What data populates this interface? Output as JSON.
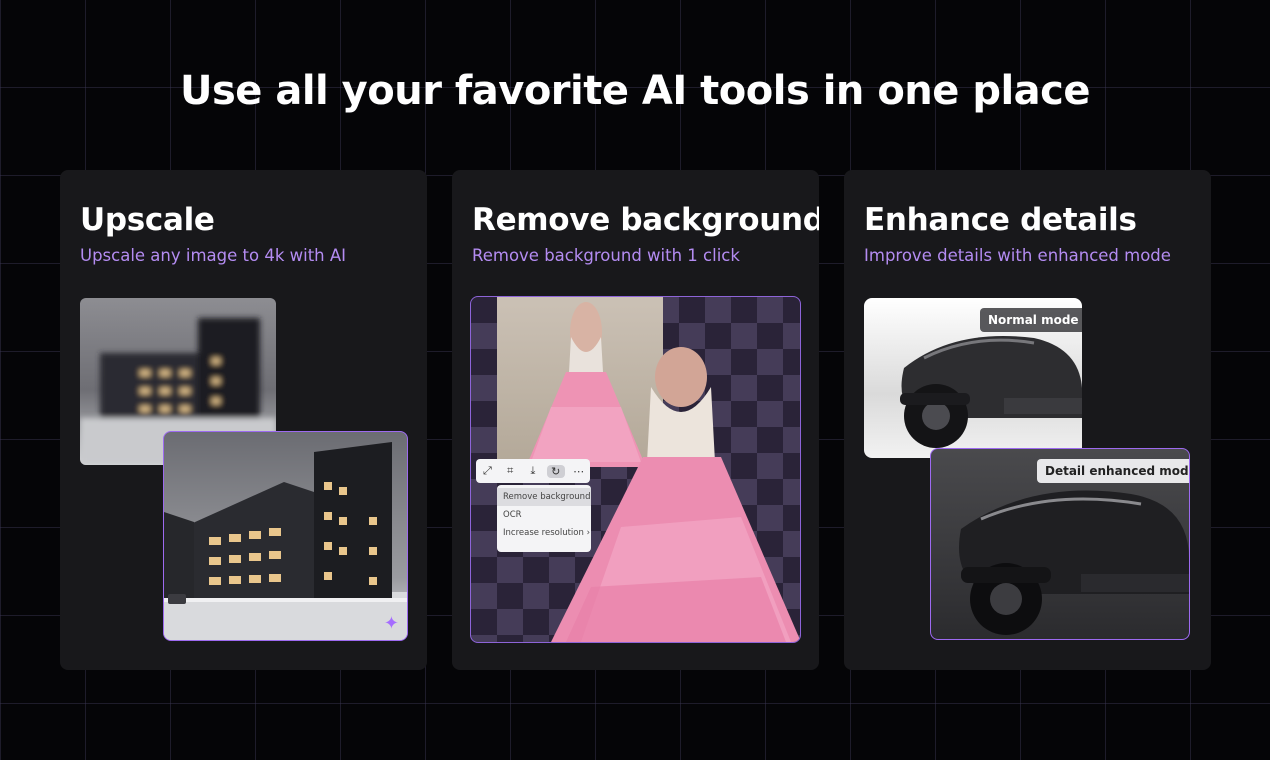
{
  "headline": "Use all your favorite AI tools in one place",
  "cards": [
    {
      "title": "Upscale",
      "subtitle": "Upscale any image to 4k with AI"
    },
    {
      "title": "Remove background",
      "subtitle": "Remove background with 1 click",
      "menu_items": [
        "Remove background",
        "OCR",
        "Increase resolution ›"
      ],
      "toolbar_icons": [
        "expand-icon",
        "crop-icon",
        "download-icon",
        "refresh-icon",
        "more-icon"
      ]
    },
    {
      "title": "Enhance details",
      "subtitle": "Improve details with enhanced mode",
      "tag_normal": "Normal mode",
      "tag_detail": "Detail enhanced mode"
    }
  ],
  "colors": {
    "background": "#050507",
    "card": "#18181b",
    "accent": "#b48cf2",
    "border_accent": "#9d6af0"
  }
}
